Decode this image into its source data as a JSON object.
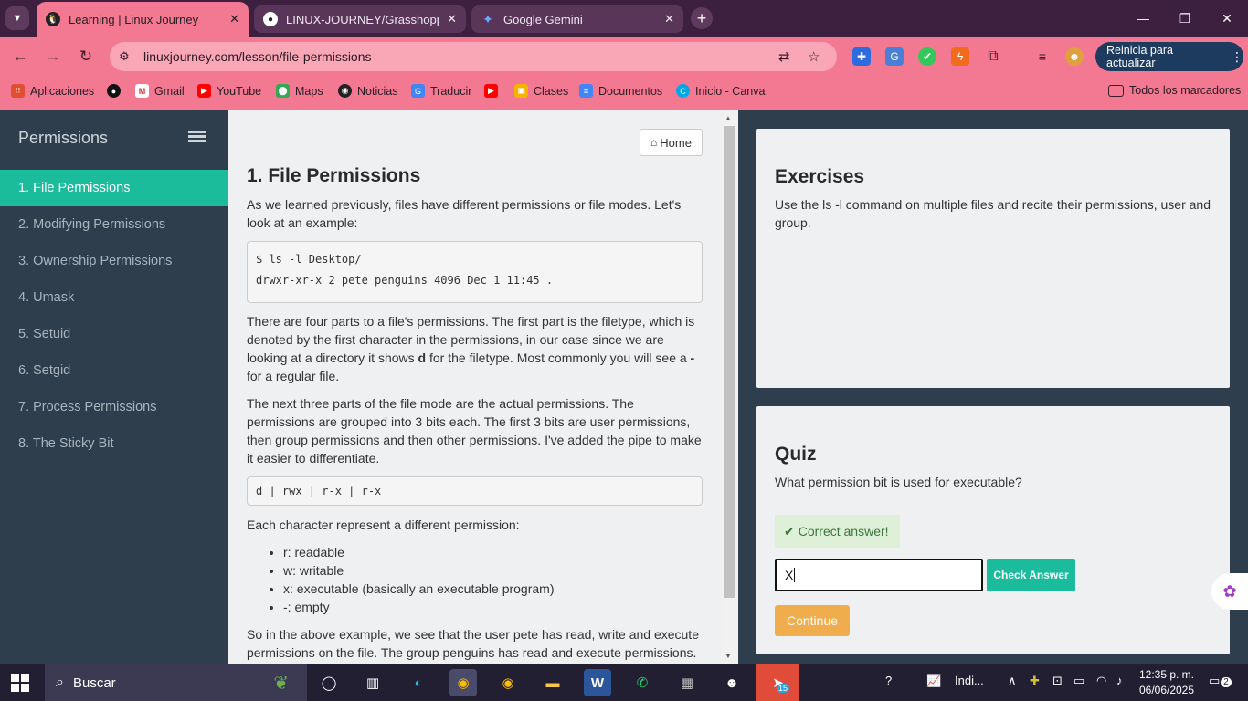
{
  "browser": {
    "tabs": [
      {
        "label": "Learning | Linux Journey",
        "icon": "penguin-icon",
        "active": true
      },
      {
        "label": "LINUX-JOURNEY/Grasshopper/",
        "icon": "github-icon",
        "active": false
      },
      {
        "label": "Google Gemini",
        "icon": "gemini-icon",
        "active": false
      }
    ],
    "url": "linuxjourney.com/lesson/file-permissions",
    "update_label": "Reinicia para actualizar",
    "bookmarks": [
      {
        "label": "Aplicaciones",
        "icon": "apps-grid-icon"
      },
      {
        "label": "",
        "icon": "github-icon"
      },
      {
        "label": "Gmail",
        "icon": "gmail-icon"
      },
      {
        "label": "YouTube",
        "icon": "youtube-icon"
      },
      {
        "label": "Maps",
        "icon": "maps-icon"
      },
      {
        "label": "Noticias",
        "icon": "news-icon"
      },
      {
        "label": "Traducir",
        "icon": "translate-icon"
      },
      {
        "label": "",
        "icon": "youtube-icon"
      },
      {
        "label": "Clases",
        "icon": "classroom-icon"
      },
      {
        "label": "Documentos",
        "icon": "docs-icon"
      },
      {
        "label": "Inicio - Canva",
        "icon": "canva-icon"
      }
    ],
    "all_bookmarks_label": "Todos los marcadores"
  },
  "sidebar": {
    "title": "Permissions",
    "items": [
      {
        "label": "1. File Permissions",
        "active": true
      },
      {
        "label": "2. Modifying Permissions",
        "active": false
      },
      {
        "label": "3. Ownership Permissions",
        "active": false
      },
      {
        "label": "4. Umask",
        "active": false
      },
      {
        "label": "5. Setuid",
        "active": false
      },
      {
        "label": "6. Setgid",
        "active": false
      },
      {
        "label": "7. Process Permissions",
        "active": false
      },
      {
        "label": "8. The Sticky Bit",
        "active": false
      }
    ]
  },
  "lesson": {
    "home_label": "Home",
    "title": "1. File Permissions",
    "intro": "As we learned previously, files have different permissions or file modes. Let's look at an example:",
    "code1_line1": "$ ls -l Desktop/",
    "code1_line2": "drwxr-xr-x 2 pete penguins 4096 Dec 1 11:45 .",
    "para2_a": "There are four parts to a file's permissions. The first part is the filetype, which is denoted by the first character in the permissions, in our case since we are looking at a directory it shows ",
    "para2_b": "d",
    "para2_c": " for the filetype. Most commonly you will see a ",
    "para2_d": "-",
    "para2_e": " for a regular file.",
    "para3": "The next three parts of the file mode are the actual permissions. The permissions are grouped into 3 bits each. The first 3 bits are user permissions, then group permissions and then other permissions. I've added the pipe to make it easier to differentiate.",
    "code2": "d | rwx | r-x | r-x",
    "para4": "Each character represent a different permission:",
    "bullets": [
      "r: readable",
      "w: writable",
      "x: executable (basically an executable program)",
      "-: empty"
    ],
    "para5": "So in the above example, we see that the user pete has read, write and execute permissions on the file. The group penguins has read and execute permissions."
  },
  "exercises": {
    "title": "Exercises",
    "text": "Use the ls -l command on multiple files and recite their permissions, user and group."
  },
  "quiz": {
    "title": "Quiz",
    "question": "What permission bit is used for executable?",
    "feedback": "Correct answer!",
    "answer_value": "X",
    "check_label": "Check Answer",
    "continue_label": "Continue"
  },
  "taskbar": {
    "search_placeholder": "Buscar",
    "weather_label": "Índi...",
    "time": "12:35 p. m.",
    "date": "06/06/2025",
    "telegram_badge": "15",
    "notification_count": "2"
  },
  "colors": {
    "accent": "#1abc9c",
    "sidebar_bg": "#2e3e4c",
    "browser_theme": "#f37892",
    "continue": "#f0ad4e"
  }
}
